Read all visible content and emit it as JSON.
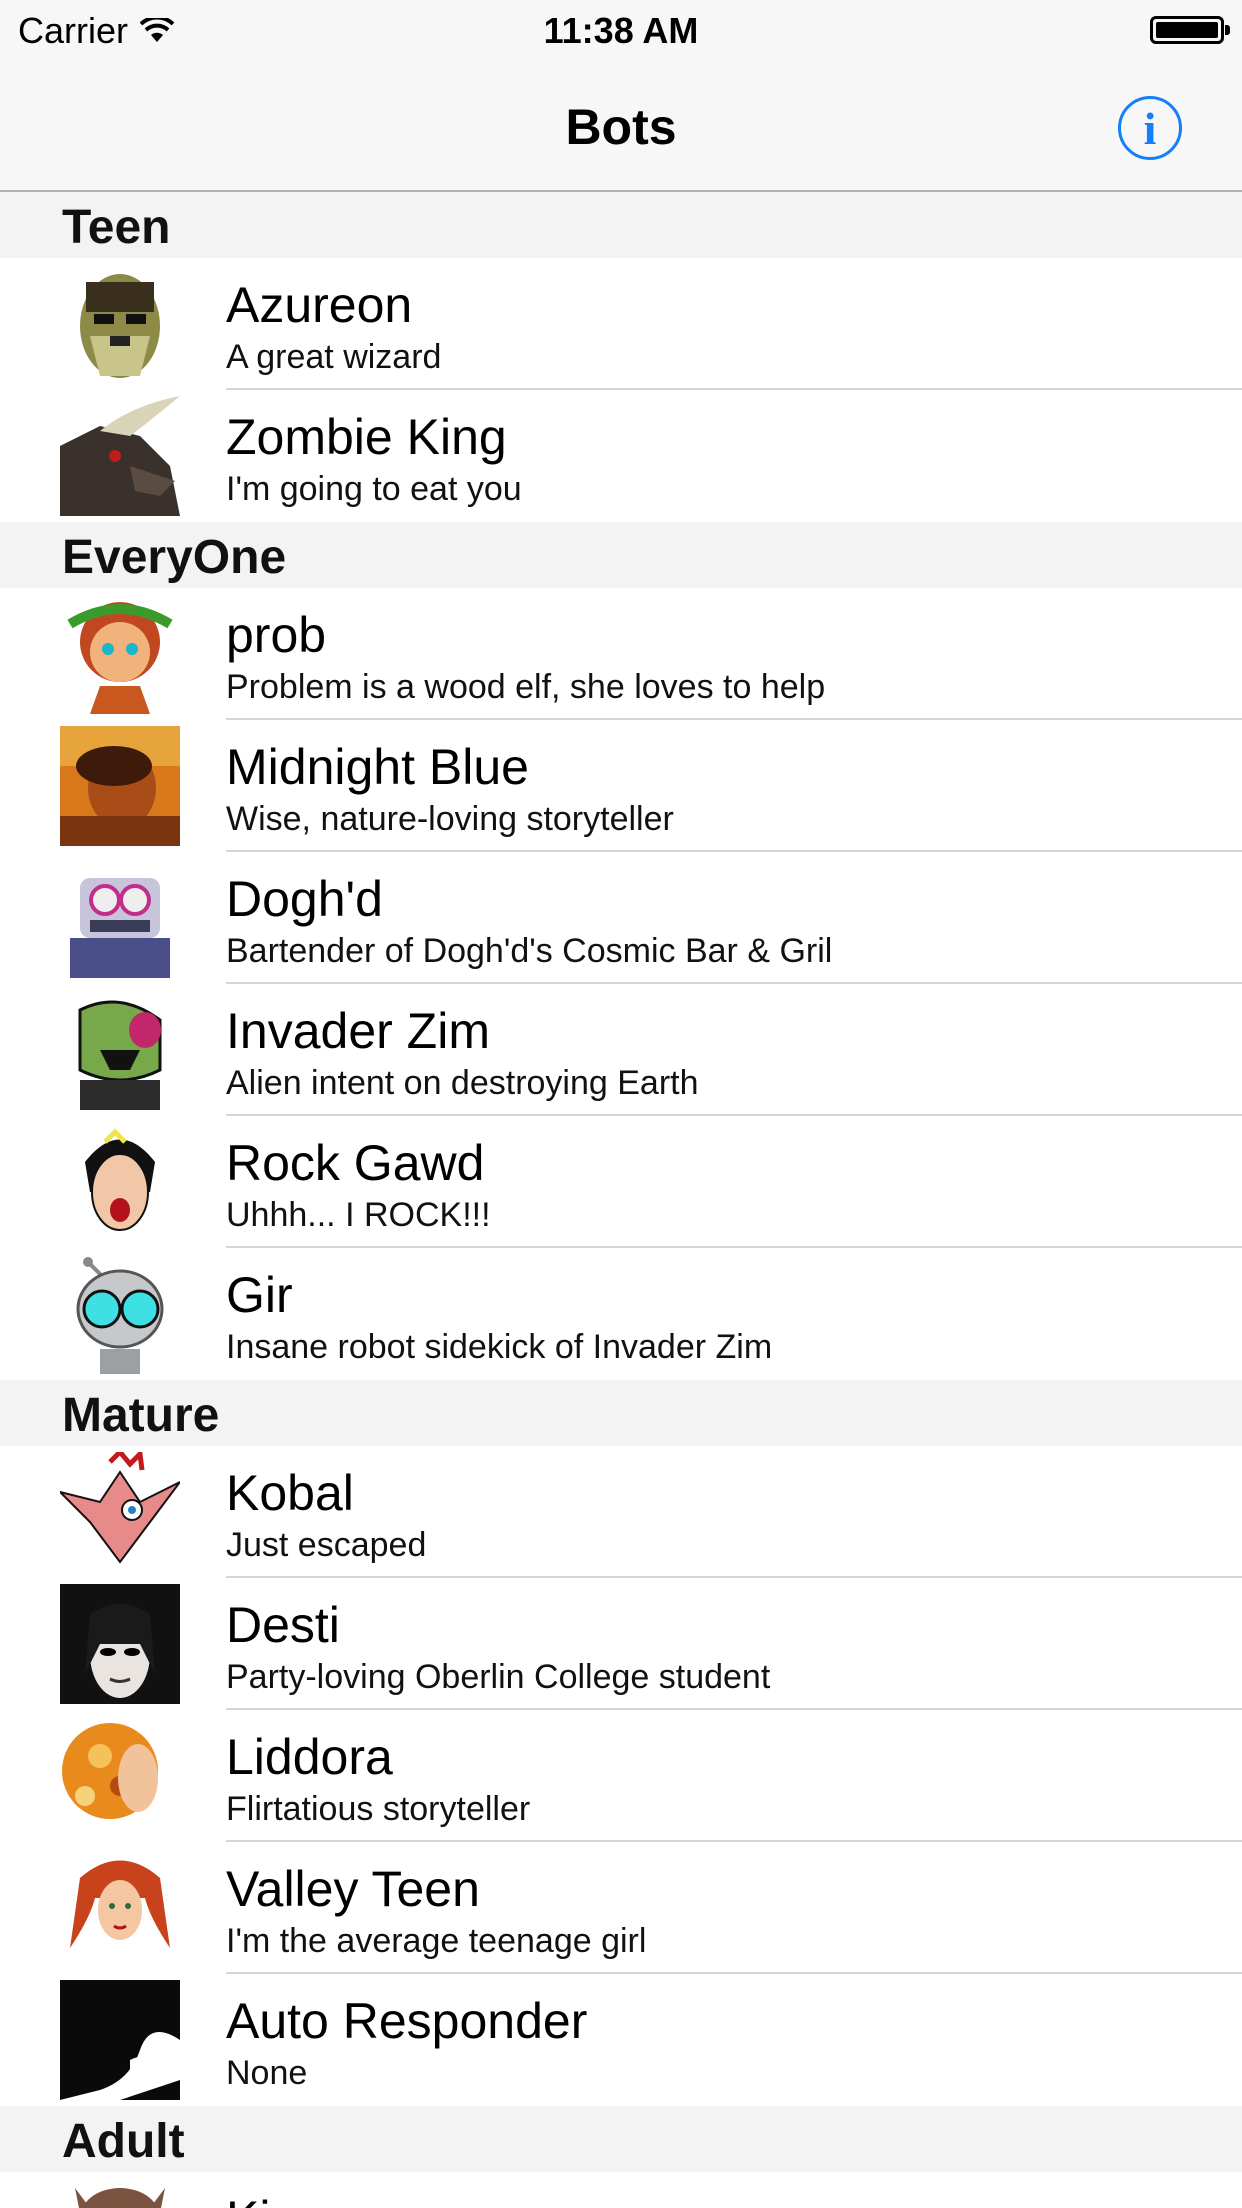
{
  "status_bar": {
    "carrier": "Carrier",
    "time": "11:38 AM"
  },
  "nav": {
    "title": "Bots",
    "info_icon": "info-icon"
  },
  "colors": {
    "accent": "#157efb",
    "section_bg": "#f3f3f3",
    "separator": "#d6d6d6"
  },
  "sections": [
    {
      "title": "Teen",
      "items": [
        {
          "name": "Azureon",
          "desc": "A great wizard"
        },
        {
          "name": "Zombie King",
          "desc": "I'm going to eat you"
        }
      ]
    },
    {
      "title": "EveryOne",
      "items": [
        {
          "name": "prob",
          "desc": "Problem is a wood elf, she loves to help"
        },
        {
          "name": "Midnight Blue",
          "desc": "Wise, nature-loving storyteller"
        },
        {
          "name": "Dogh'd",
          "desc": "Bartender of Dogh'd's Cosmic Bar & Gril"
        },
        {
          "name": "Invader Zim",
          "desc": "Alien intent on destroying Earth"
        },
        {
          "name": "Rock Gawd",
          "desc": "Uhhh... I ROCK!!!"
        },
        {
          "name": "Gir",
          "desc": "Insane robot sidekick of Invader Zim"
        }
      ]
    },
    {
      "title": "Mature",
      "items": [
        {
          "name": "Kobal",
          "desc": "Just escaped"
        },
        {
          "name": "Desti",
          "desc": "Party-loving Oberlin College student"
        },
        {
          "name": "Liddora",
          "desc": "Flirtatious storyteller"
        },
        {
          "name": "Valley Teen",
          "desc": "I'm the average teenage girl"
        },
        {
          "name": "Auto Responder",
          "desc": "None"
        }
      ]
    },
    {
      "title": "Adult",
      "items": [
        {
          "name": "Ki",
          "desc": ""
        }
      ]
    }
  ]
}
